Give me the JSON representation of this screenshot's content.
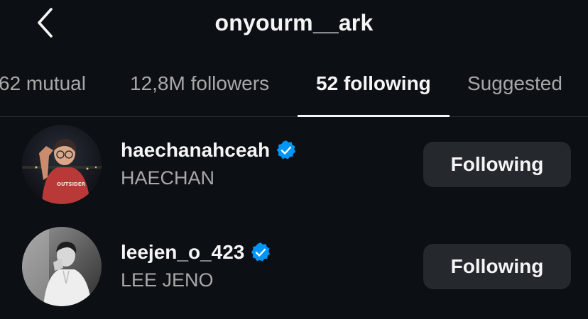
{
  "header": {
    "back_icon": "chevron-left-icon",
    "title": "onyourm__ark"
  },
  "tabs": [
    {
      "label": "62 mutual",
      "active": false
    },
    {
      "label": "12,8M followers",
      "active": false
    },
    {
      "label": "52 following",
      "active": true
    },
    {
      "label": "Suggested",
      "active": false
    }
  ],
  "colors": {
    "background": "#0c1014",
    "primary_text": "#f5f5f5",
    "secondary_text": "#a8a8a8",
    "button_bg": "#25292e",
    "verified_badge": "#0095f6"
  },
  "accounts": [
    {
      "username": "haechanahceah",
      "full_name": "HAECHAN",
      "verified": true,
      "button_label": "Following"
    },
    {
      "username": "leejen_o_423",
      "full_name": "LEE JENO",
      "verified": true,
      "button_label": "Following"
    }
  ]
}
